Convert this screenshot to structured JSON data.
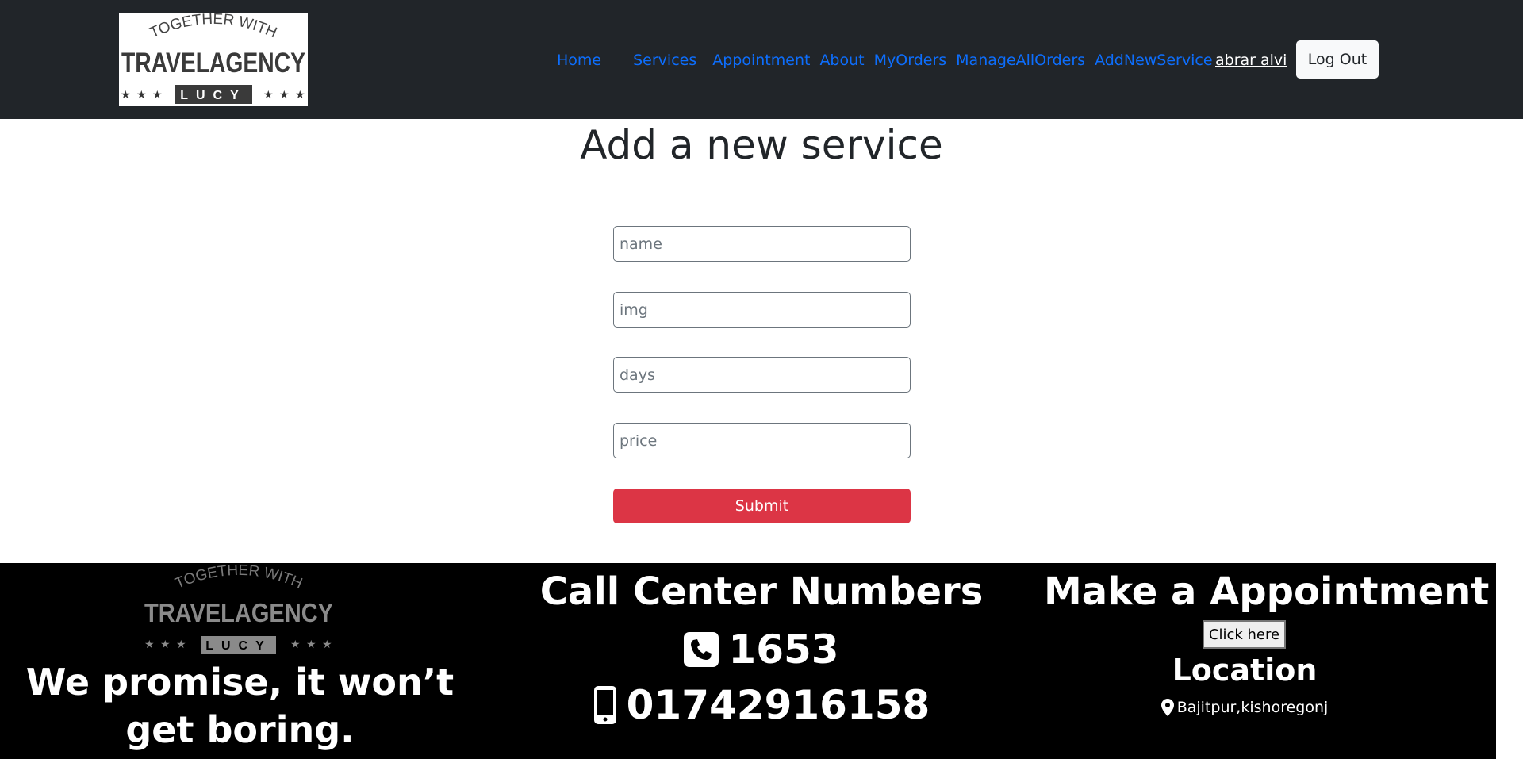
{
  "header": {
    "logo": {
      "top_text": "TOGETHER WITH",
      "main_text": "TRAVELAGENCY",
      "sub_text": "LUCY"
    },
    "nav_links": [
      "Home",
      "Services",
      "Appointment",
      "About",
      "MyOrders",
      "ManageAllOrders",
      "AddNewService"
    ],
    "user_name": "abrar alvi",
    "logout_label": "Log Out"
  },
  "main": {
    "title": "Add a new service",
    "fields": {
      "name_placeholder": "name",
      "img_placeholder": "img",
      "days_placeholder": "days",
      "price_placeholder": "price"
    },
    "submit_label": "Submit"
  },
  "footer": {
    "logo": {
      "top_text": "TOGETHER WITH",
      "main_text": "TRAVELAGENCY",
      "sub_text": "LUCY"
    },
    "tagline": "We promise, it won’t get boring.",
    "call_center_title": "Call Center Numbers",
    "hotline": "1653",
    "mobile": "01742916158",
    "appointment_title": "Make a Appointment",
    "click_here_label": "Click here",
    "location_title": "Location",
    "location": "Bajitpur,kishoregonj"
  },
  "colors": {
    "navbar_bg": "#212529",
    "link": "#0d6efd",
    "submit_bg": "#dc3545",
    "footer_bg": "#000000",
    "footer_logo_text": "#888888"
  },
  "icons": {
    "call_center": "phone-square-icon",
    "mobile": "mobile-phone-icon",
    "location": "map-pin-icon"
  }
}
